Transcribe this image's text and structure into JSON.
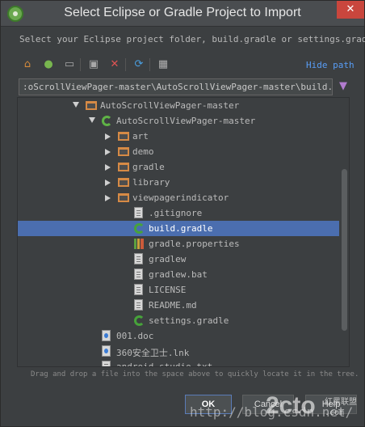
{
  "window": {
    "title": "Select Eclipse or Gradle Project to Import",
    "close_glyph": "✕"
  },
  "prompt": "Select your Eclipse project folder, build.gradle or settings.gradle",
  "toolbar": {
    "icons": [
      "home-icon",
      "android-icon",
      "folder-icon",
      "new-folder-icon",
      "delete-icon",
      "refresh-icon",
      "show-hidden-icon"
    ],
    "hide_path_label": "Hide path"
  },
  "path": {
    "value": ":oScrollViewPager-master\\AutoScrollViewPager-master\\build.gradle"
  },
  "tree": {
    "items": [
      {
        "label": "AutoScrollViewPager-master",
        "icon": "folder-icon",
        "expanded": true
      },
      {
        "label": "AutoScrollViewPager-master",
        "icon": "module-icon",
        "expanded": true
      },
      {
        "label": "art",
        "icon": "folder-icon",
        "expanded": false
      },
      {
        "label": "demo",
        "icon": "folder-icon",
        "expanded": false
      },
      {
        "label": "gradle",
        "icon": "folder-icon",
        "expanded": false
      },
      {
        "label": "library",
        "icon": "folder-icon",
        "expanded": false
      },
      {
        "label": "viewpagerindicator",
        "icon": "folder-icon",
        "expanded": false
      },
      {
        "label": ".gitignore",
        "icon": "file-icon"
      },
      {
        "label": "build.gradle",
        "icon": "gradle-icon",
        "selected": true
      },
      {
        "label": "gradle.properties",
        "icon": "properties-icon"
      },
      {
        "label": "gradlew",
        "icon": "file-icon"
      },
      {
        "label": "gradlew.bat",
        "icon": "file-icon"
      },
      {
        "label": "LICENSE",
        "icon": "file-icon"
      },
      {
        "label": "README.md",
        "icon": "file-icon"
      },
      {
        "label": "settings.gradle",
        "icon": "gradle-icon"
      },
      {
        "label": "001.doc",
        "icon": "doc-file-icon"
      },
      {
        "label": "360安全卫士.lnk",
        "icon": "shortcut-file-icon"
      },
      {
        "label": "android-studio.txt",
        "icon": "file-icon"
      }
    ]
  },
  "hint": "Drag and drop a file into the space above to quickly locate it in the tree.",
  "buttons": {
    "ok": "OK",
    "cancel": "Cancel",
    "help": "Help"
  },
  "watermark": {
    "url_text": "http://blog.csdn.net/",
    "logo": "2cto",
    "logo_sub_line1": "红黑联盟",
    "logo_sub_line2": ".com"
  },
  "colors": {
    "background": "#3c3f41",
    "selection": "#4b6eaf",
    "link": "#589df6",
    "folder": "#d68a45",
    "gradle": "#47a33a",
    "close_button": "#c9463d"
  }
}
